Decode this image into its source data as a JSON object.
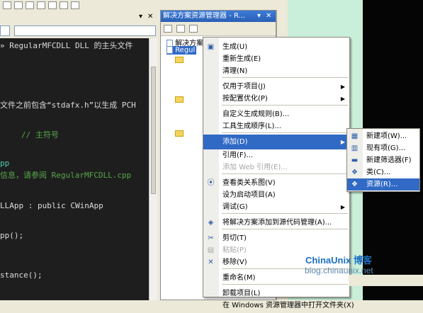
{
  "editor": {
    "lines": [
      {
        "text": "RegularMFCDLL DLL 的主头文件",
        "color": "#dcdcdc",
        "prefix": "» "
      },
      {
        "text": "文件之前包含“stdafx.h”以生成 PCH",
        "color": "#dcdcdc",
        "prefix": ""
      },
      {
        "text": "// 主符号",
        "color": "#57a64a",
        "prefix": ""
      },
      {
        "text": "pp",
        "color": "#dcdcdc",
        "prefix": ""
      },
      {
        "text": "信息，请参阅 RegularMFCDLL.cpp",
        "color": "#57a64a",
        "prefix": ""
      },
      {
        "text": "LLApp : public CWinApp",
        "color": "#dcdcdc",
        "prefix": ""
      },
      {
        "text": "pp();",
        "color": "#dcdcdc",
        "prefix": ""
      },
      {
        "text": "stance();",
        "color": "#dcdcdc",
        "prefix": ""
      }
    ],
    "tab_close": "✕",
    "pin": "▾"
  },
  "solution_explorer": {
    "title": "解决方案资源管理器 - R...",
    "pin": "▾",
    "close": "✕",
    "tree": [
      {
        "label": "解决方案",
        "type": "solution"
      },
      {
        "label": "Regul",
        "type": "project"
      }
    ]
  },
  "context_menu": {
    "items": [
      {
        "label": "生成(U)",
        "icon": "build-icon",
        "glyph": "▣",
        "arrow": false,
        "disabled": false
      },
      {
        "label": "重新生成(E)",
        "icon": "",
        "glyph": "",
        "arrow": false,
        "disabled": false
      },
      {
        "label": "清理(N)",
        "icon": "",
        "glyph": "",
        "arrow": false,
        "disabled": false
      },
      {
        "label": "仅用于项目(J)",
        "icon": "",
        "glyph": "",
        "arrow": true,
        "disabled": false
      },
      {
        "label": "按配置优化(P)",
        "icon": "",
        "glyph": "",
        "arrow": true,
        "disabled": false
      },
      {
        "label": "自定义生成规则(B)...",
        "icon": "",
        "glyph": "",
        "arrow": false,
        "disabled": false
      },
      {
        "label": "工具生成顺序(L)...",
        "icon": "",
        "glyph": "",
        "arrow": false,
        "disabled": false
      },
      {
        "label": "添加(D)",
        "icon": "",
        "glyph": "",
        "arrow": true,
        "disabled": false,
        "highlight": true
      },
      {
        "label": "引用(F)...",
        "icon": "",
        "glyph": "",
        "arrow": false,
        "disabled": false
      },
      {
        "label": "添加 Web 引用(E)...",
        "icon": "",
        "glyph": "",
        "arrow": false,
        "disabled": true
      },
      {
        "label": "查看类关系图(V)",
        "icon": "class-diagram-icon",
        "glyph": "⦿",
        "arrow": false,
        "disabled": false
      },
      {
        "label": "设为启动项目(A)",
        "icon": "",
        "glyph": "",
        "arrow": false,
        "disabled": false
      },
      {
        "label": "调试(G)",
        "icon": "",
        "glyph": "",
        "arrow": true,
        "disabled": false
      },
      {
        "label": "将解决方案添加到源代码管理(A)...",
        "icon": "source-control-icon",
        "glyph": "◈",
        "arrow": false,
        "disabled": false
      },
      {
        "label": "剪切(T)",
        "icon": "scissors-icon",
        "glyph": "✂",
        "arrow": false,
        "disabled": false
      },
      {
        "label": "粘贴(P)",
        "icon": "paste-icon",
        "glyph": "▤",
        "arrow": false,
        "disabled": true
      },
      {
        "label": "移除(V)",
        "icon": "remove-icon",
        "glyph": "✕",
        "arrow": false,
        "disabled": false
      },
      {
        "label": "重命名(M)",
        "icon": "",
        "glyph": "",
        "arrow": false,
        "disabled": false
      },
      {
        "label": "卸载项目(L)",
        "icon": "",
        "glyph": "",
        "arrow": false,
        "disabled": false
      },
      {
        "label": "在 Windows 资源管理器中打开文件夹(X)",
        "icon": "",
        "glyph": "",
        "arrow": false,
        "disabled": false
      }
    ]
  },
  "submenu": {
    "items": [
      {
        "label": "新建项(W)...",
        "icon": "new-item-icon",
        "glyph": "▦"
      },
      {
        "label": "现有项(G)...",
        "icon": "existing-item-icon",
        "glyph": "▥"
      },
      {
        "label": "新建筛选器(F)",
        "icon": "new-filter-icon",
        "glyph": "▬"
      },
      {
        "label": "类(C)...",
        "icon": "class-icon",
        "glyph": "❖"
      },
      {
        "label": "资源(R)...",
        "icon": "resource-icon",
        "glyph": "❖",
        "highlight": true
      }
    ]
  },
  "watermark": {
    "logo": "ChinaUnix 博客",
    "blog": "blog.chinaunix.net"
  },
  "colors": {
    "highlight": "#316ac5",
    "editor_bg": "#1e1e1e",
    "title_bar": "#2a5fb6"
  }
}
